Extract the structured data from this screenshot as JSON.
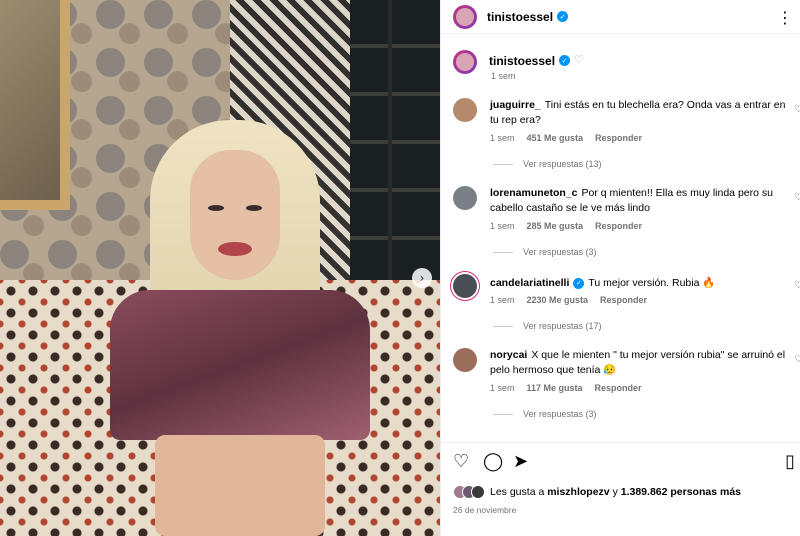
{
  "post": {
    "username": "tinistoessel",
    "caption_time": "1 sem",
    "date": "26 de noviembre"
  },
  "icons": {
    "verified": "verified-check-icon",
    "more": "more-horizontal-icon",
    "like": "heart-icon",
    "comment": "comment-icon",
    "share": "send-icon",
    "save": "bookmark-icon",
    "carousel_next": "chevron-right-icon"
  },
  "colors": {
    "verified": "#0095f6",
    "meta_text": "#737373"
  },
  "comments": [
    {
      "user": "juaguirre_",
      "text": "Tini estás en tu blechella era? Onda vas a entrar en tu rep era?",
      "time": "1 sem",
      "likes": "451 Me gusta",
      "reply": "Responder",
      "replies": "Ver respuestas (13)",
      "verified": false
    },
    {
      "user": "lorenamuneton_c",
      "text": "Por q mienten!! Ella es muy linda pero su cabello castaño se le ve más lindo",
      "time": "1 sem",
      "likes": "285 Me gusta",
      "reply": "Responder",
      "replies": "Ver respuestas (3)",
      "verified": false
    },
    {
      "user": "candelariatinelli",
      "text": "Tu mejor versión. Rubia 🔥",
      "time": "1 sem",
      "likes": "2230 Me gusta",
      "reply": "Responder",
      "replies": "Ver respuestas (17)",
      "verified": true
    },
    {
      "user": "norycai",
      "text": "X que le mienten \" tu mejor versión rubia\" se arruinó el pelo hermoso que tenía 😥",
      "time": "1 sem",
      "likes": "117 Me gusta",
      "reply": "Responder",
      "replies": "Ver respuestas (3)",
      "verified": false
    }
  ],
  "likes": {
    "prefix": "Les gusta a",
    "user": "miszhlopezv",
    "middle": "y",
    "count": "1.389.862 personas más"
  }
}
